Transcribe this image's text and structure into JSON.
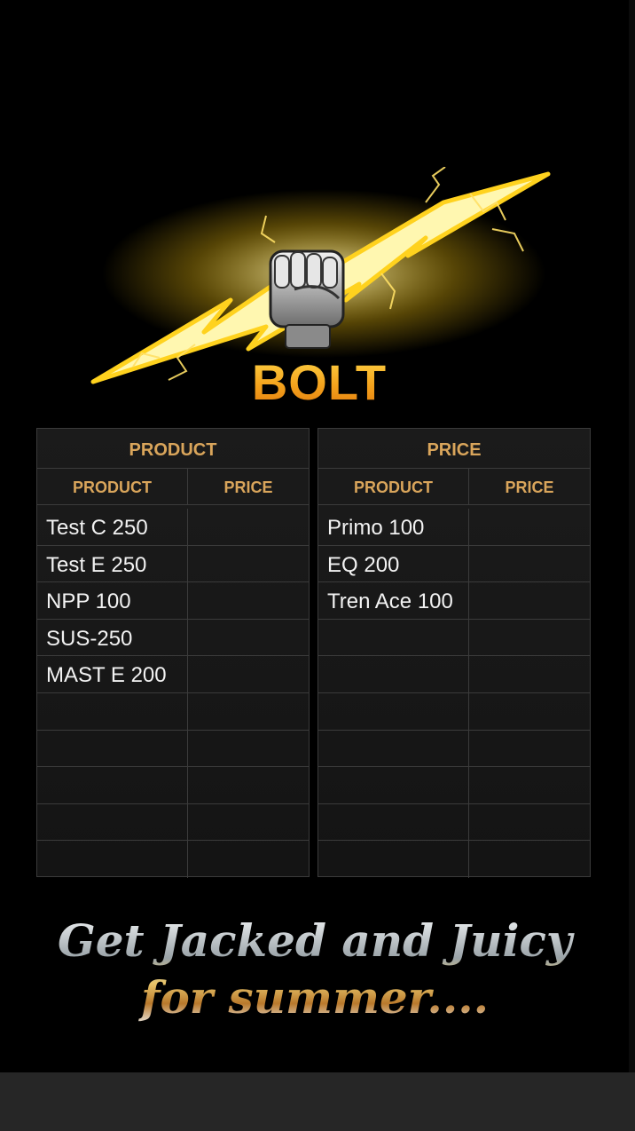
{
  "brand": {
    "name": "BOLT"
  },
  "tables": [
    {
      "title": "PRODUCT",
      "col_product": "PRODUCT",
      "col_price": "PRICE",
      "rows": [
        {
          "product": "Test C 250",
          "price": ""
        },
        {
          "product": "Test E 250",
          "price": ""
        },
        {
          "product": "NPP 100",
          "price": ""
        },
        {
          "product": "SUS-250",
          "price": ""
        },
        {
          "product": "MAST E 200",
          "price": ""
        },
        {
          "product": "",
          "price": ""
        },
        {
          "product": "",
          "price": ""
        },
        {
          "product": "",
          "price": ""
        },
        {
          "product": "",
          "price": ""
        },
        {
          "product": "",
          "price": ""
        }
      ]
    },
    {
      "title": "PRICE",
      "col_product": "PRODUCT",
      "col_price": "PRICE",
      "rows": [
        {
          "product": "Primo 100",
          "price": ""
        },
        {
          "product": "EQ 200",
          "price": ""
        },
        {
          "product": "Tren Ace 100",
          "price": ""
        },
        {
          "product": "",
          "price": ""
        },
        {
          "product": "",
          "price": ""
        },
        {
          "product": "",
          "price": ""
        },
        {
          "product": "",
          "price": ""
        },
        {
          "product": "",
          "price": ""
        },
        {
          "product": "",
          "price": ""
        },
        {
          "product": "",
          "price": ""
        }
      ]
    }
  ],
  "tagline": {
    "line1": "Get Jacked and Juicy",
    "line2": "for summer...."
  },
  "colors": {
    "header_gold": "#d9a55b",
    "brand_orange": "#f2a41c",
    "bottom_bar": "#262626"
  },
  "icons": {
    "logo": "lightning-fist-icon"
  }
}
